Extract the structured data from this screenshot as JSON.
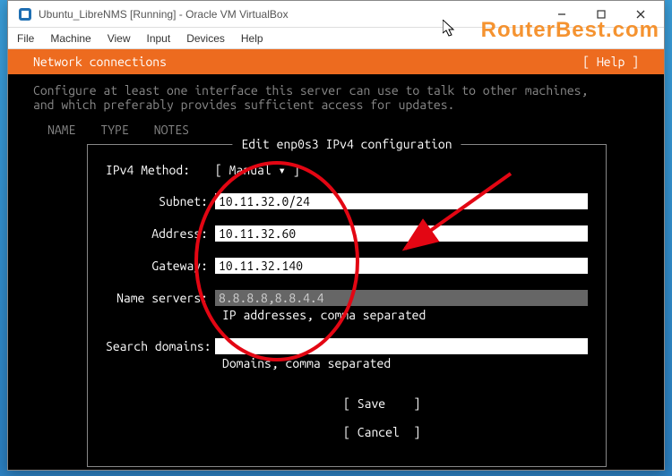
{
  "window": {
    "title": "Ubuntu_LibreNMS [Running] - Oracle VM VirtualBox"
  },
  "menubar": [
    "File",
    "Machine",
    "View",
    "Input",
    "Devices",
    "Help"
  ],
  "topbar": {
    "title": "Network connections",
    "help": "[ Help ]"
  },
  "description": "Configure at least one interface this server can use to talk to other machines, and which preferably provides sufficient access for updates.",
  "columns": [
    "NAME",
    "TYPE",
    "NOTES"
  ],
  "panel_title": "Edit enp0s3 IPv4 configuration",
  "method": {
    "label": "IPv4 Method:",
    "value": "[ Manual           ▾ ]"
  },
  "fields": {
    "subnet": {
      "label": "Subnet:",
      "value": "10.11.32.0/24"
    },
    "address": {
      "label": "Address:",
      "value": "10.11.32.60"
    },
    "gateway": {
      "label": "Gateway:",
      "value": "10.11.32.140"
    },
    "dns": {
      "label": "Name servers:",
      "value": "8.8.8.8,8.8.4.4",
      "hint": "IP addresses, comma separated"
    },
    "search": {
      "label": "Search domains:",
      "value": "",
      "hint": "Domains, comma separated"
    }
  },
  "buttons": {
    "save": "[ Save    ]",
    "cancel": "[ Cancel  ]"
  },
  "watermark": "RouterBest.com"
}
